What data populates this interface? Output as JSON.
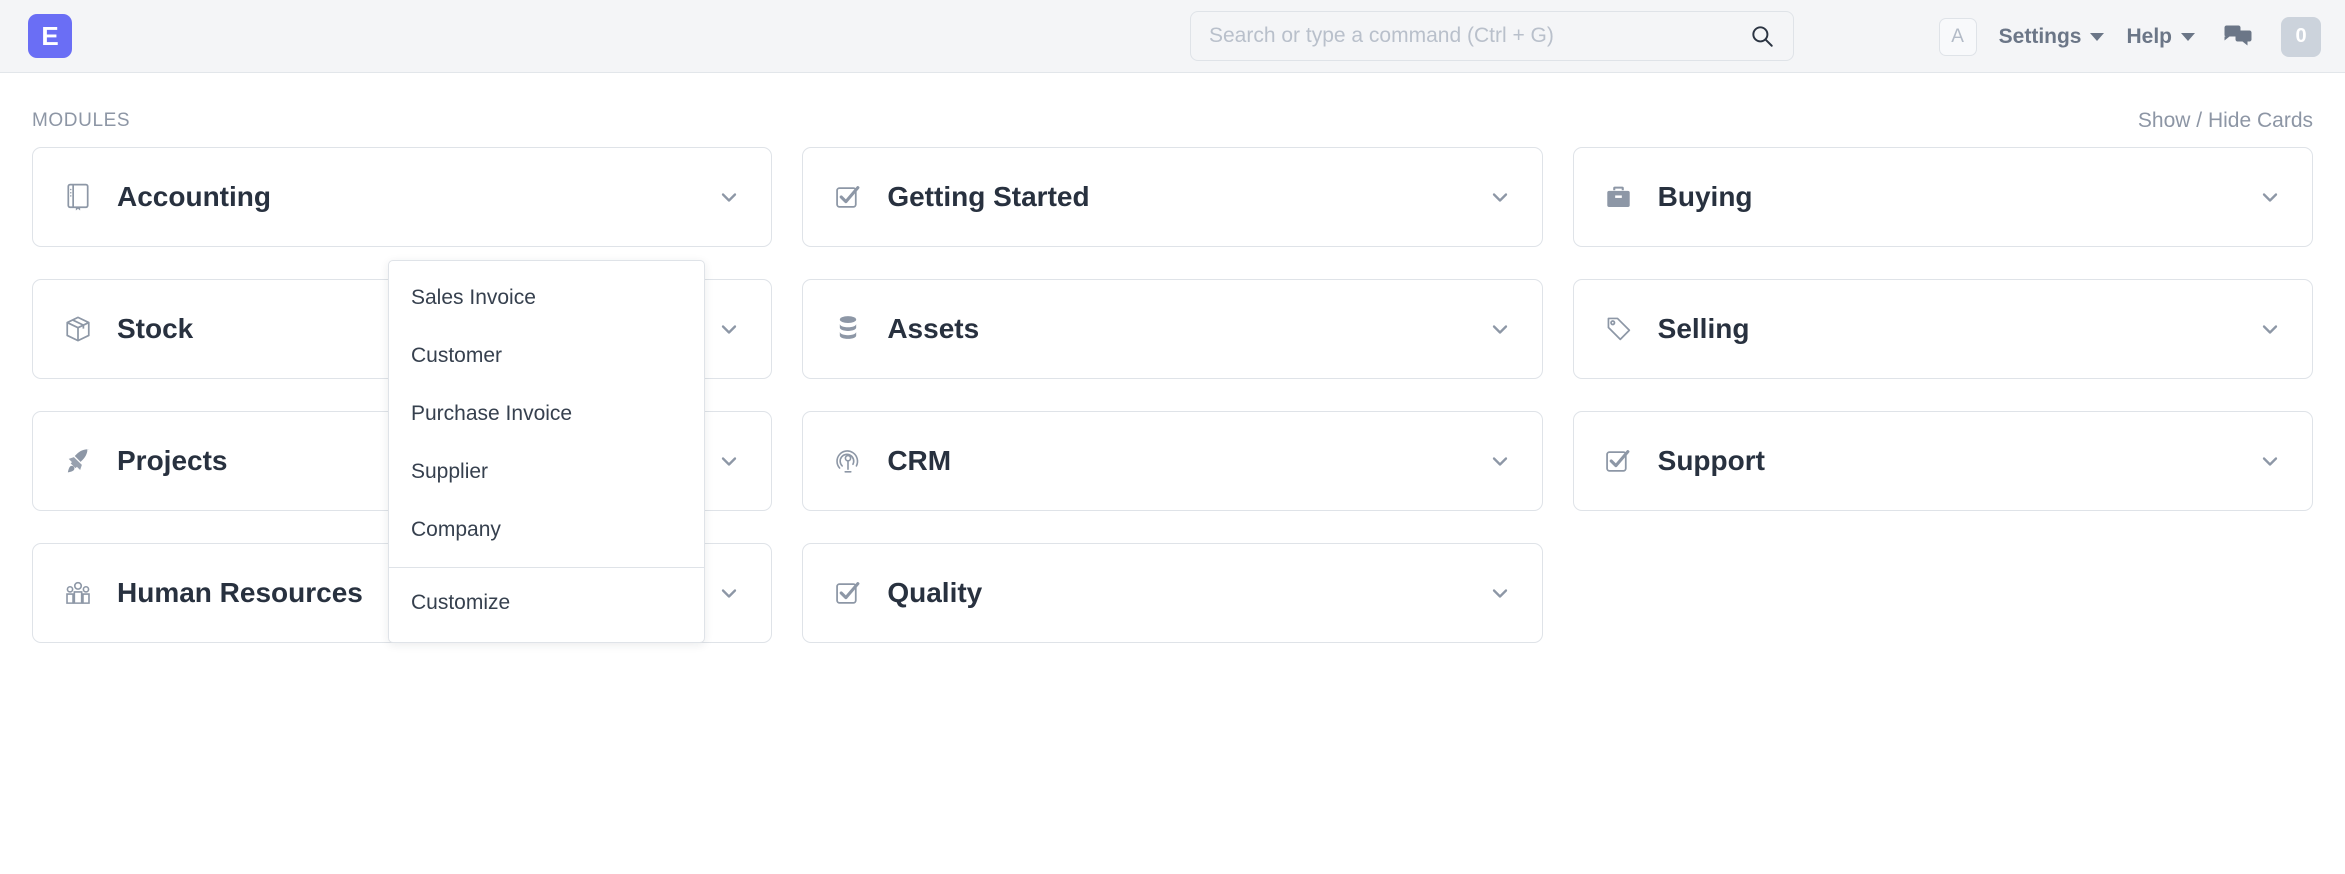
{
  "navbar": {
    "logo_letter": "E",
    "search": {
      "placeholder": "Search or type a command (Ctrl + G)",
      "value": "",
      "icon": "search-icon"
    },
    "avatar_letter": "A",
    "settings_label": "Settings",
    "help_label": "Help",
    "chat_icon": "chat-bubbles-icon",
    "notification_count": "0"
  },
  "page": {
    "section_title": "MODULES",
    "show_hide_label": "Show / Hide Cards"
  },
  "cards": [
    {
      "label": "Accounting",
      "icon": "book-icon",
      "chevron": "chevron-down-icon",
      "expanded": true
    },
    {
      "label": "Getting Started",
      "icon": "checkbox-icon",
      "chevron": "chevron-down-icon",
      "expanded": false
    },
    {
      "label": "Buying",
      "icon": "briefcase-icon",
      "chevron": "chevron-down-icon",
      "expanded": false
    },
    {
      "label": "Stock",
      "icon": "box-icon",
      "chevron": "chevron-down-icon",
      "expanded": false
    },
    {
      "label": "Assets",
      "icon": "database-icon",
      "chevron": "chevron-down-icon",
      "expanded": false
    },
    {
      "label": "Selling",
      "icon": "tag-icon",
      "chevron": "chevron-down-icon",
      "expanded": false
    },
    {
      "label": "Projects",
      "icon": "rocket-icon",
      "chevron": "chevron-down-icon",
      "expanded": false
    },
    {
      "label": "CRM",
      "icon": "crm-target-icon",
      "chevron": "chevron-down-icon",
      "expanded": false
    },
    {
      "label": "Support",
      "icon": "checkbox-icon",
      "chevron": "chevron-down-icon",
      "expanded": false
    },
    {
      "label": "Human Resources",
      "icon": "people-icon",
      "chevron": "chevron-down-icon",
      "expanded": false
    },
    {
      "label": "Quality",
      "icon": "checkbox-icon",
      "chevron": "chevron-down-icon",
      "expanded": false
    }
  ],
  "dropdown": {
    "owner": "Accounting",
    "items": [
      {
        "label": "Sales Invoice"
      },
      {
        "label": "Customer"
      },
      {
        "label": "Purchase Invoice"
      },
      {
        "label": "Supplier"
      },
      {
        "label": "Company"
      }
    ],
    "footer_item": {
      "label": "Customize"
    }
  },
  "colors": {
    "brand": "#6a6ef5",
    "navbar_bg": "#f4f5f7",
    "border": "#dfe3e8",
    "text_strong": "#28313f",
    "text_muted": "#8d96a5",
    "badge_bg": "#ccd3dc"
  }
}
